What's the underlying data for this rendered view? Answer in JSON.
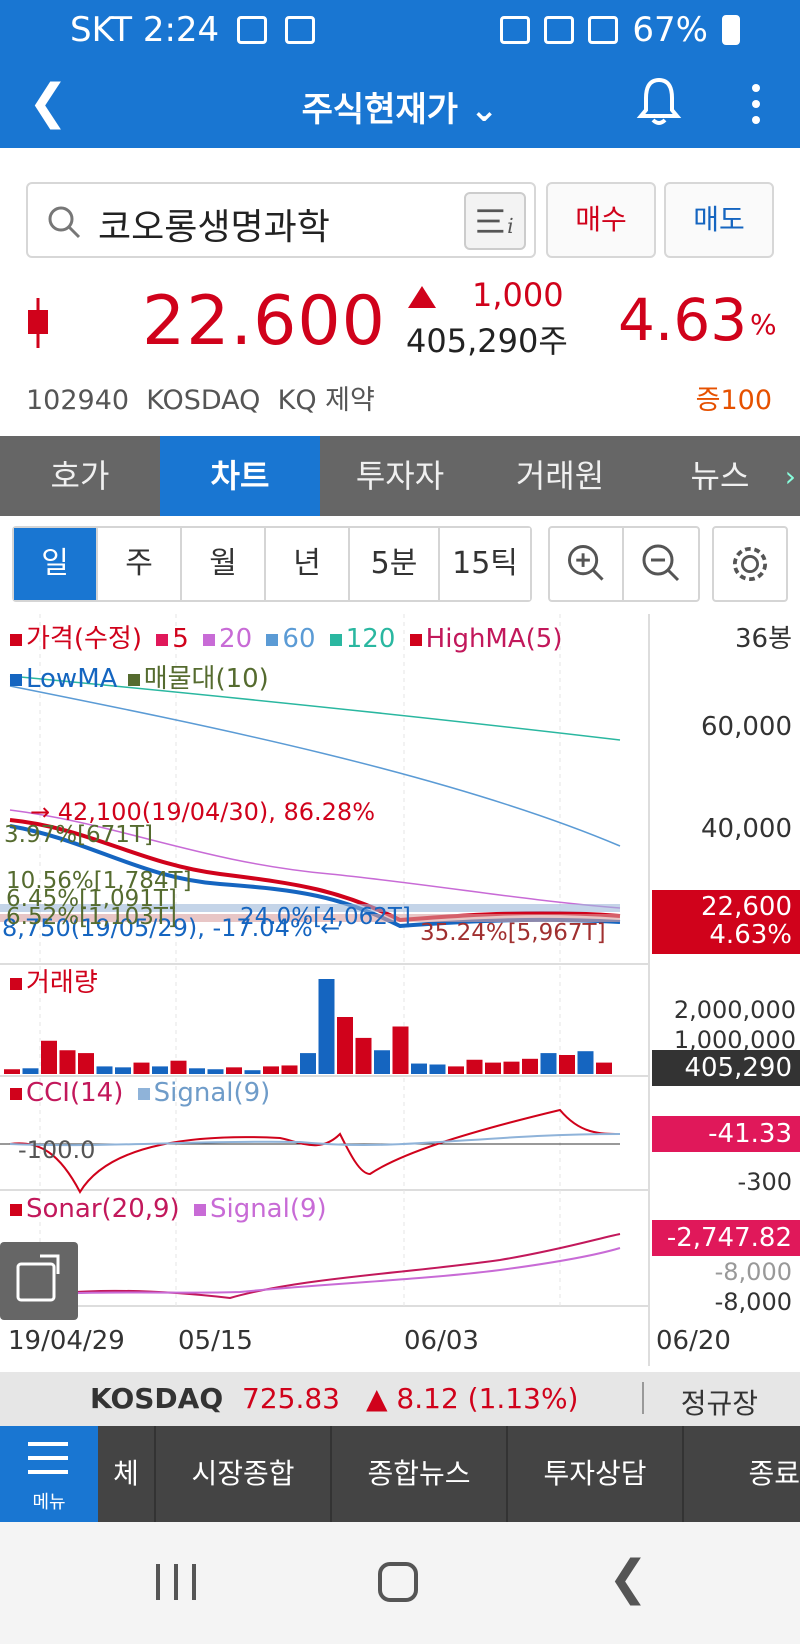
{
  "status_bar": {
    "carrier_time": "SKT 2:24",
    "battery": "67%"
  },
  "app_bar": {
    "title": "주식현재가 ⌄"
  },
  "search": {
    "stock_name": "코오롱생명과학",
    "buy_label": "매수",
    "sell_label": "매도"
  },
  "quote": {
    "price": "22.600",
    "change": "1,000",
    "volume": "405,290주",
    "change_pct": "4.63",
    "pct_sign": "%",
    "code": "102940",
    "market": "KOSDAQ",
    "sector": "KQ 제약",
    "margin": "증100",
    "up_color": "#d0021b",
    "down_color": "#1565c0"
  },
  "tabs": [
    "호가",
    "차트",
    "투자자",
    "거래원",
    "뉴스"
  ],
  "active_tab": "차트",
  "periods": [
    "일",
    "주",
    "월",
    "년",
    "5분",
    "15틱"
  ],
  "active_period": "일",
  "chart": {
    "bars_count": "36봉",
    "price_legend": [
      "가격(수정)",
      "5",
      "20",
      "60",
      "120",
      "HighMA(5)"
    ],
    "price_legend2": [
      "LowMA",
      "매물대(10)"
    ],
    "high_note": "→ 42,100(19/04/30), 86.28%",
    "low_note": "8,750(19/05/29), -17.04% ←",
    "vp_labels": [
      "3.97%[671T]",
      "10.56%[1,784T]",
      "6.45%[1,091T]",
      "6.52%[1,103T]",
      "24.0%[4,062T]",
      "35.24%[5,967T]"
    ],
    "price_axis": [
      "60,000",
      "40,000"
    ],
    "price_tag": [
      "22,600",
      "4.63%"
    ],
    "volume_legend": "거래량",
    "volume_axis": [
      "2,000,000",
      "1,000,000"
    ],
    "volume_tag": "405,290",
    "cci_legend": [
      "CCI(14)",
      "Signal(9)"
    ],
    "cci_axis": [
      "-100.0",
      "-300"
    ],
    "cci_tag": "-41.33",
    "sonar_legend": [
      "Sonar(20,9)",
      "Signal(9)"
    ],
    "sonar_axis": [
      "-8,000",
      "-8,000"
    ],
    "sonar_tag": "-2,747.82",
    "x_labels": [
      "19/04/29",
      "05/15",
      "06/03",
      "06/20"
    ]
  },
  "ticker": {
    "index": "KOSDAQ",
    "value": "725.83",
    "change": "▲ 8.12 (1.13%)",
    "session": "정규장"
  },
  "bottom_nav": {
    "menu_label": "메뉴",
    "items": [
      "체",
      "시장종합",
      "종합뉴스",
      "투자상담",
      "종료"
    ]
  },
  "chart_data": {
    "type": "candlestick",
    "title": "",
    "x_labels": [
      "19/04/29",
      "05/15",
      "06/03",
      "06/20"
    ],
    "price_range": [
      8000,
      70000
    ],
    "current_price": 22600,
    "ma_colors": {
      "5": "#e0185a",
      "20": "#c86bd6",
      "60": "#5b9bd5",
      "120": "#2ab7a0"
    },
    "volume_values": [
      5,
      6,
      35,
      25,
      22,
      8,
      7,
      12,
      8,
      14,
      6,
      5,
      7,
      4,
      8,
      9,
      22,
      100,
      60,
      38,
      25,
      50,
      11,
      10,
      8,
      15,
      12,
      13,
      16,
      22,
      20,
      24,
      12
    ],
    "volume_colors": [
      "r",
      "b",
      "r",
      "r",
      "r",
      "b",
      "b",
      "r",
      "b",
      "r",
      "b",
      "b",
      "r",
      "b",
      "r",
      "r",
      "b",
      "b",
      "r",
      "r",
      "b",
      "r",
      "b",
      "b",
      "r",
      "r",
      "r",
      "r",
      "r",
      "b",
      "r",
      "b",
      "r"
    ],
    "volume_unit_max": 2000000
  }
}
